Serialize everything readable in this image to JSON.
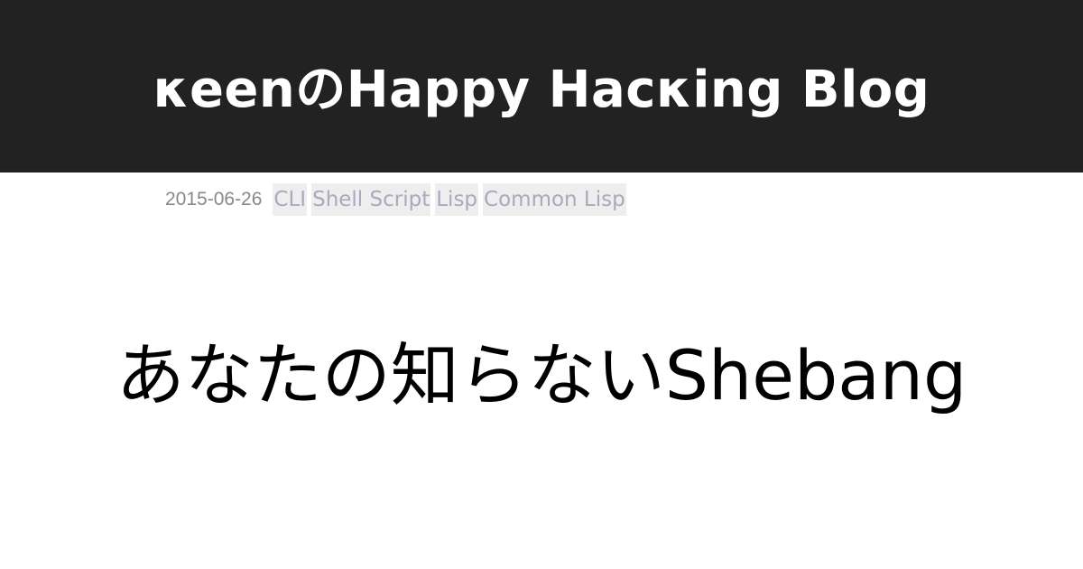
{
  "header": {
    "blog_title": "κeenのHappy Hacκing Blog",
    "background_color": "#222222",
    "text_color": "#ffffff"
  },
  "post": {
    "date": "2015-06-26",
    "tags": [
      "CLI",
      "Shell Script",
      "Lisp",
      "Common Lisp"
    ],
    "title": "あなたの知らないShebang"
  },
  "colors": {
    "tag_text": "#a9a9bd",
    "tag_background": "#eeeeee",
    "date_text": "#888888"
  }
}
